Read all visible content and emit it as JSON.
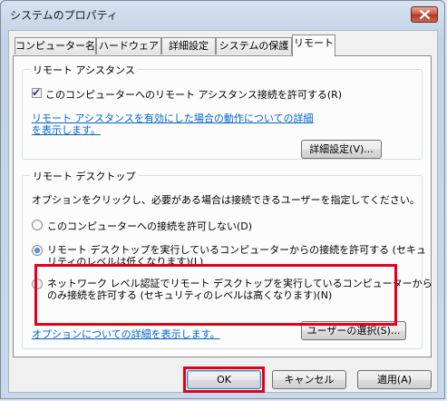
{
  "window": {
    "title": "システムのプロパティ"
  },
  "tabs": [
    {
      "label": "コンピューター名"
    },
    {
      "label": "ハードウェア"
    },
    {
      "label": "詳細設定"
    },
    {
      "label": "システムの保護"
    },
    {
      "label": "リモート"
    }
  ],
  "remote_assistance": {
    "group_label": "リモート アシスタンス",
    "allow_checkbox": {
      "label": "このコンピューターへのリモート アシスタンス接続を許可する(R)",
      "checked": true
    },
    "info_link": {
      "line1": "リモート アシスタンスを有効にした場合の動作についての詳細",
      "line2": "を表示します。"
    },
    "advanced_button": "詳細設定(V)..."
  },
  "remote_desktop": {
    "group_label": "リモート デスクトップ",
    "description": "オプションをクリックし、必要がある場合は接続できるユーザーを指定してください。",
    "options": [
      {
        "line1": "このコンピューターへの接続を許可しない(D)",
        "line2": "",
        "selected": false
      },
      {
        "line1": "リモート デスクトップを実行しているコンピューターからの接続を許可する (セキュ",
        "line2": "リティのレベルは低くなります)(L)",
        "selected": true
      },
      {
        "line1": "ネットワーク レベル認証でリモート デスクトップを実行しているコンピューターから",
        "line2": "のみ接続を許可する (セキュリティのレベルは高くなります)(N)",
        "selected": false
      }
    ],
    "help_link": "オプションについての詳細を表示します。",
    "select_users_button": "ユーザーの選択(S)..."
  },
  "footer": {
    "ok": "OK",
    "cancel": "キャンセル",
    "apply": "適用(A)"
  },
  "colors": {
    "highlight": "#e4001b",
    "link": "#0066cc"
  }
}
